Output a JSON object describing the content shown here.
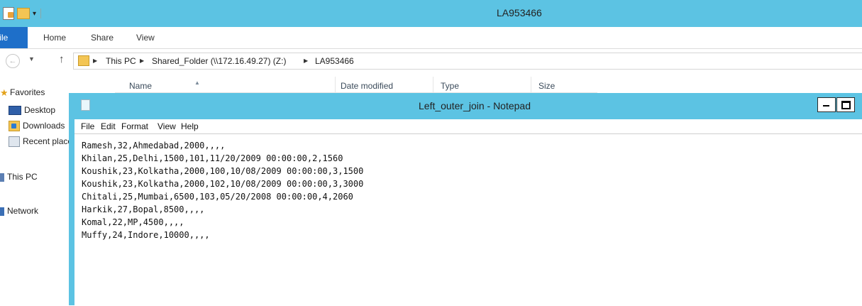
{
  "window": {
    "title": "LA953466"
  },
  "qat": {
    "icons": [
      "properties-icon",
      "new-folder-icon",
      "customize-qat-icon"
    ]
  },
  "ribbon": {
    "file_label": "File",
    "tabs": [
      {
        "label": "Home"
      },
      {
        "label": "Share"
      },
      {
        "label": "View"
      }
    ]
  },
  "address": {
    "crumbs": [
      {
        "label": "This PC"
      },
      {
        "label": "Shared_Folder (\\\\172.16.49.27) (Z:)"
      },
      {
        "label": "LA953466"
      }
    ]
  },
  "nav": {
    "favorites": "Favorites",
    "desktop": "Desktop",
    "downloads": "Downloads",
    "recent": "Recent places",
    "thispc": "This PC",
    "network": "Network"
  },
  "columns": [
    {
      "label": "Name"
    },
    {
      "label": "Date modified"
    },
    {
      "label": "Type"
    },
    {
      "label": "Size"
    }
  ],
  "notepad": {
    "title": "Left_outer_join - Notepad",
    "menu": [
      {
        "label": "File"
      },
      {
        "label": "Edit"
      },
      {
        "label": "Format"
      },
      {
        "label": "View"
      },
      {
        "label": "Help"
      }
    ],
    "lines": [
      "Ramesh,32,Ahmedabad,2000,,,,",
      "Khilan,25,Delhi,1500,101,11/20/2009 00:00:00,2,1560",
      "Koushik,23,Kolkatha,2000,100,10/08/2009 00:00:00,3,1500",
      "Koushik,23,Kolkatha,2000,102,10/08/2009 00:00:00,3,3000",
      "Chitali,25,Mumbai,6500,103,05/20/2008 00:00:00,4,2060",
      "Harkik,27,Bopal,8500,,,,",
      "Komal,22,MP,4500,,,,",
      "Muffy,24,Indore,10000,,,,"
    ]
  }
}
